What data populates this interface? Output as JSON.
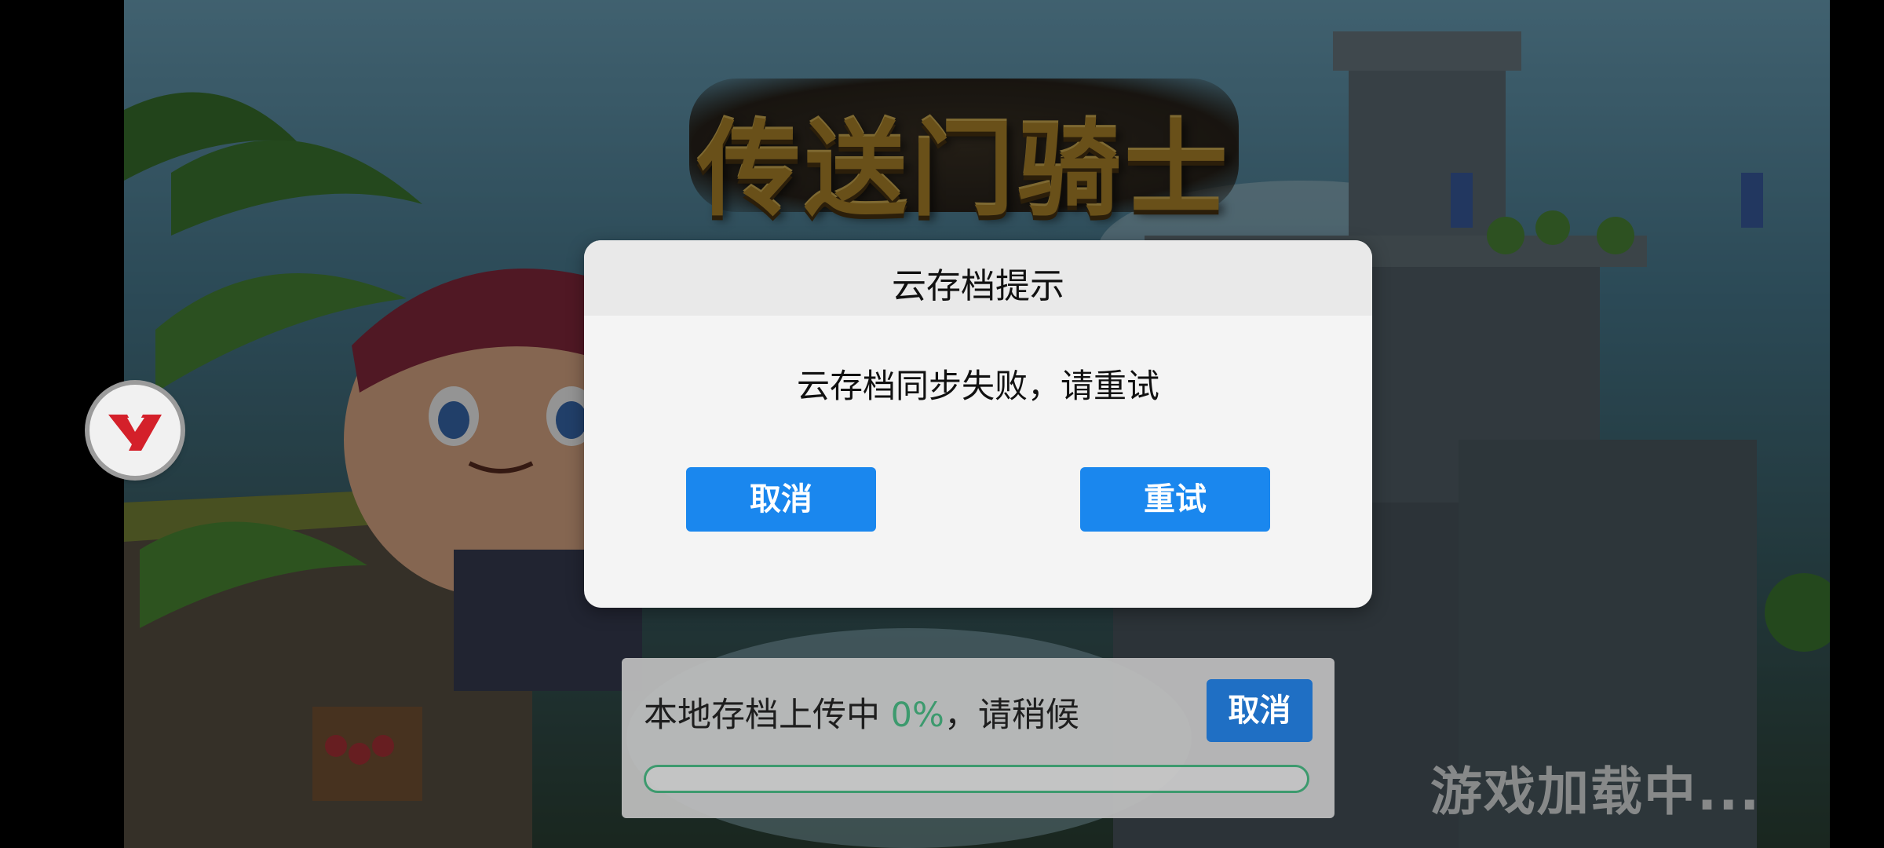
{
  "game": {
    "logo_text": "传送门骑士",
    "loading_text": "游戏加载中...",
    "badge_icon": "y7-logo-icon"
  },
  "dialog": {
    "title": "云存档提示",
    "message": "云存档同步失败，请重试",
    "cancel_label": "取消",
    "retry_label": "重试"
  },
  "upload": {
    "message_prefix": "本地存档上传中 ",
    "percent_text": "0%",
    "message_suffix": "，请稍候",
    "cancel_label": "取消",
    "progress": 0
  },
  "colors": {
    "primary_button": "#1a87ee",
    "progress_green": "#3d9a6e",
    "logo_gold": "#b58a2c",
    "badge_red": "#d4202a"
  }
}
